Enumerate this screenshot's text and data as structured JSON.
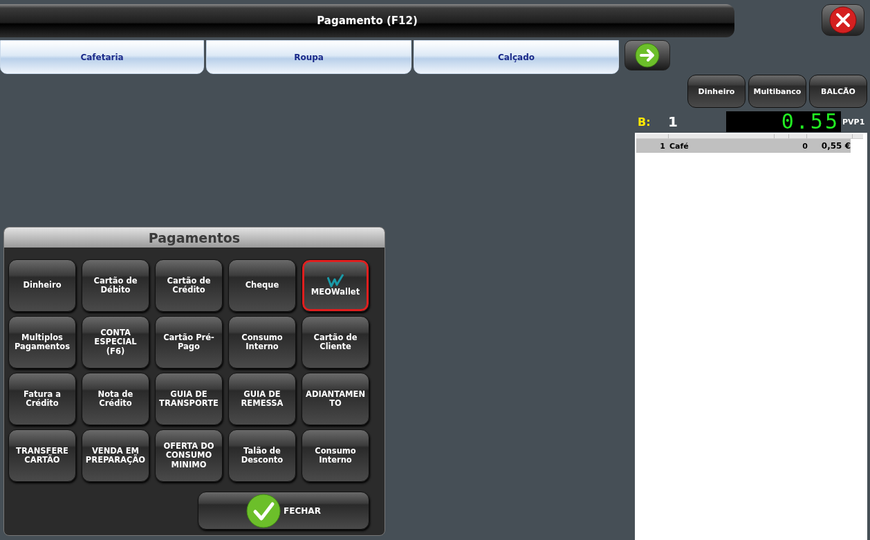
{
  "window": {
    "title": "Pagamento (F12)"
  },
  "tabs": [
    {
      "label": "Cafetaria",
      "selected": false
    },
    {
      "label": "Roupa",
      "selected": false
    },
    {
      "label": "Calçado",
      "selected": false
    }
  ],
  "quick_buttons": [
    "Dinheiro",
    "Multibanco",
    "BALCÃO"
  ],
  "display": {
    "label": "B:",
    "number": "1",
    "amount": "0.55",
    "price_level": "PVP1"
  },
  "order": {
    "rows": [
      {
        "qty": "1",
        "item": "Café",
        "column_3": "0",
        "price": "0,55 €",
        "selected": true
      }
    ]
  },
  "payments": {
    "title": "Pagamentos",
    "buttons": [
      {
        "label": "Dinheiro",
        "kind": "text",
        "selected": false
      },
      {
        "label": "Cartão de\nDébito",
        "kind": "text",
        "selected": false
      },
      {
        "label": "Cartão de\nCrédito",
        "kind": "text",
        "selected": false
      },
      {
        "label": "Cheque",
        "kind": "text",
        "selected": false
      },
      {
        "label": "MEOWallet",
        "kind": "logo",
        "selected": true
      },
      {
        "label": "Multiplos\nPagamentos",
        "kind": "text",
        "selected": false
      },
      {
        "label": "CONTA\nESPECIAL\n(F6)",
        "kind": "text",
        "selected": false
      },
      {
        "label": "Cartão Pré-\nPago",
        "kind": "text",
        "selected": false
      },
      {
        "label": "Consumo\nInterno",
        "kind": "text",
        "selected": false
      },
      {
        "label": "Cartão de\nCliente",
        "kind": "text",
        "selected": false
      },
      {
        "label": "Fatura a\nCrédito",
        "kind": "text",
        "selected": false
      },
      {
        "label": "Nota de\nCrédito",
        "kind": "text",
        "selected": false
      },
      {
        "label": "GUIA DE\nTRANSPORTE",
        "kind": "text",
        "selected": false
      },
      {
        "label": "GUIA DE\nREMESSA",
        "kind": "text",
        "selected": false
      },
      {
        "label": "ADIANTAMEN\nTO",
        "kind": "text",
        "selected": false
      },
      {
        "label": "TRANSFERE\nCARTÃO",
        "kind": "text",
        "selected": false
      },
      {
        "label": "VENDA EM\nPREPARAÇÃO",
        "kind": "text",
        "selected": false
      },
      {
        "label": "OFERTA DO\nCONSUMO\nMINIMO",
        "kind": "text",
        "selected": false
      },
      {
        "label": "Talão de\nDesconto",
        "kind": "text",
        "selected": false
      },
      {
        "label": "Consumo\nInterno",
        "kind": "text",
        "selected": false
      }
    ],
    "close_button": "FECHAR"
  }
}
